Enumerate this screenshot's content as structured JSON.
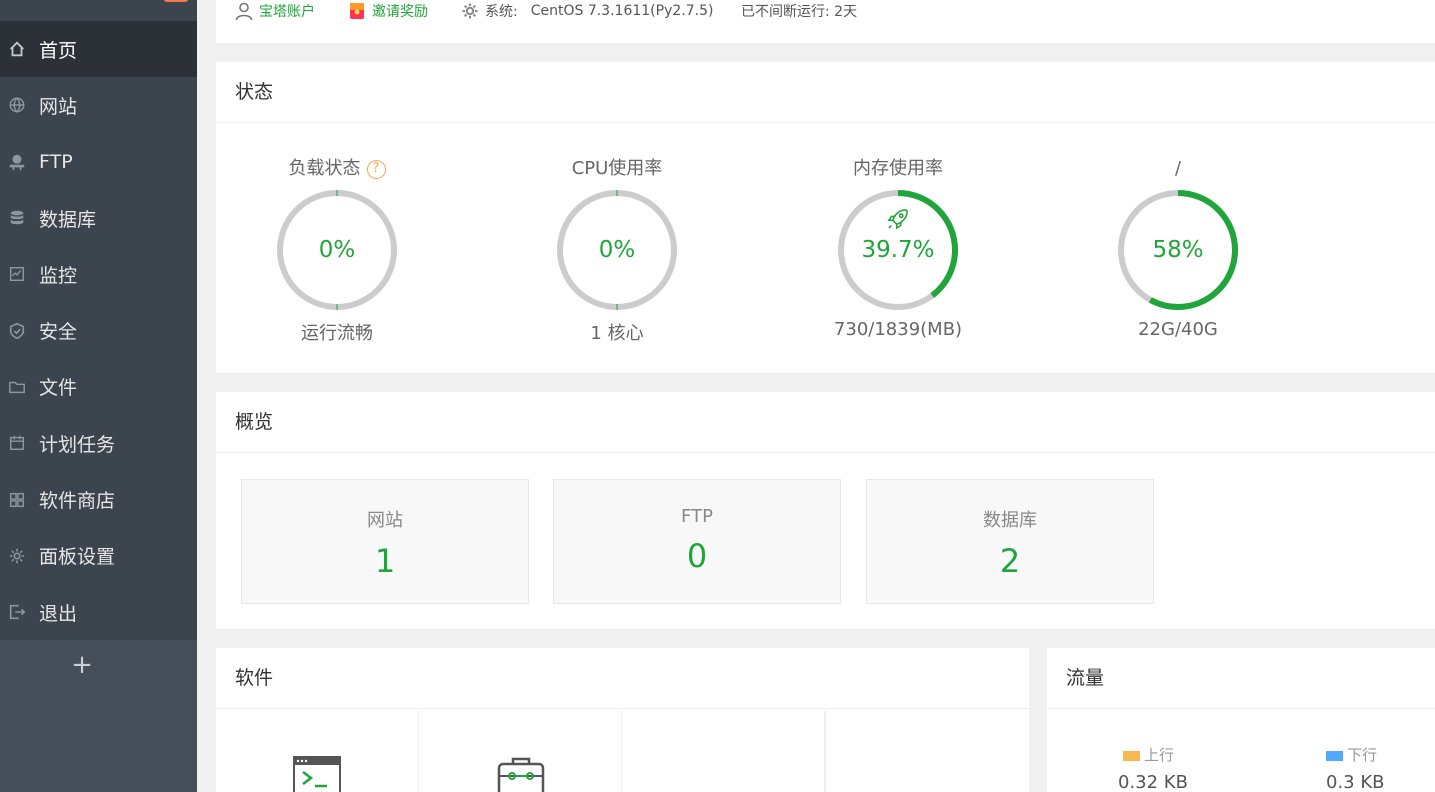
{
  "sidebar": {
    "items": [
      {
        "label": "首页",
        "icon": "home-icon",
        "active": true
      },
      {
        "label": "网站",
        "icon": "globe-icon"
      },
      {
        "label": "FTP",
        "icon": "ftp-icon"
      },
      {
        "label": "数据库",
        "icon": "database-icon"
      },
      {
        "label": "监控",
        "icon": "monitor-icon"
      },
      {
        "label": "安全",
        "icon": "shield-icon"
      },
      {
        "label": "文件",
        "icon": "folder-icon"
      },
      {
        "label": "计划任务",
        "icon": "calendar-icon"
      },
      {
        "label": "软件商店",
        "icon": "grid-icon"
      },
      {
        "label": "面板设置",
        "icon": "gear-icon"
      },
      {
        "label": "退出",
        "icon": "logout-icon"
      }
    ],
    "add_label": "+"
  },
  "topbar": {
    "account": "宝塔账户",
    "invite": "邀请奖励",
    "system_label": "系统:",
    "system_value": "CentOS 7.3.1611(Py2.7.5)",
    "uptime": "已不间断运行: 2天"
  },
  "status": {
    "title": "状态",
    "load": {
      "title": "负载状态",
      "value": "0%",
      "sub": "运行流畅",
      "percent": 0
    },
    "cpu": {
      "title": "CPU使用率",
      "value": "0%",
      "sub": "1 核心",
      "percent": 0
    },
    "mem": {
      "title": "内存使用率",
      "value": "39.7%",
      "sub": "730/1839(MB)",
      "percent": 39.7
    },
    "disk": {
      "title": "/",
      "value": "58%",
      "sub": "22G/40G",
      "percent": 58
    }
  },
  "overview": {
    "title": "概览",
    "cards": [
      {
        "label": "网站",
        "value": "1"
      },
      {
        "label": "FTP",
        "value": "0"
      },
      {
        "label": "数据库",
        "value": "2"
      }
    ]
  },
  "software": {
    "title": "软件"
  },
  "traffic": {
    "title": "流量",
    "up_label": "上行",
    "down_label": "下行",
    "up_value": "0.32 KB",
    "down_value": "0.3 KB",
    "up_color": "#f7b851",
    "down_color": "#52a9ff"
  },
  "colors": {
    "accent": "#20a53a",
    "sidebar": "#3c444d",
    "ring_bg": "#cccccc"
  }
}
